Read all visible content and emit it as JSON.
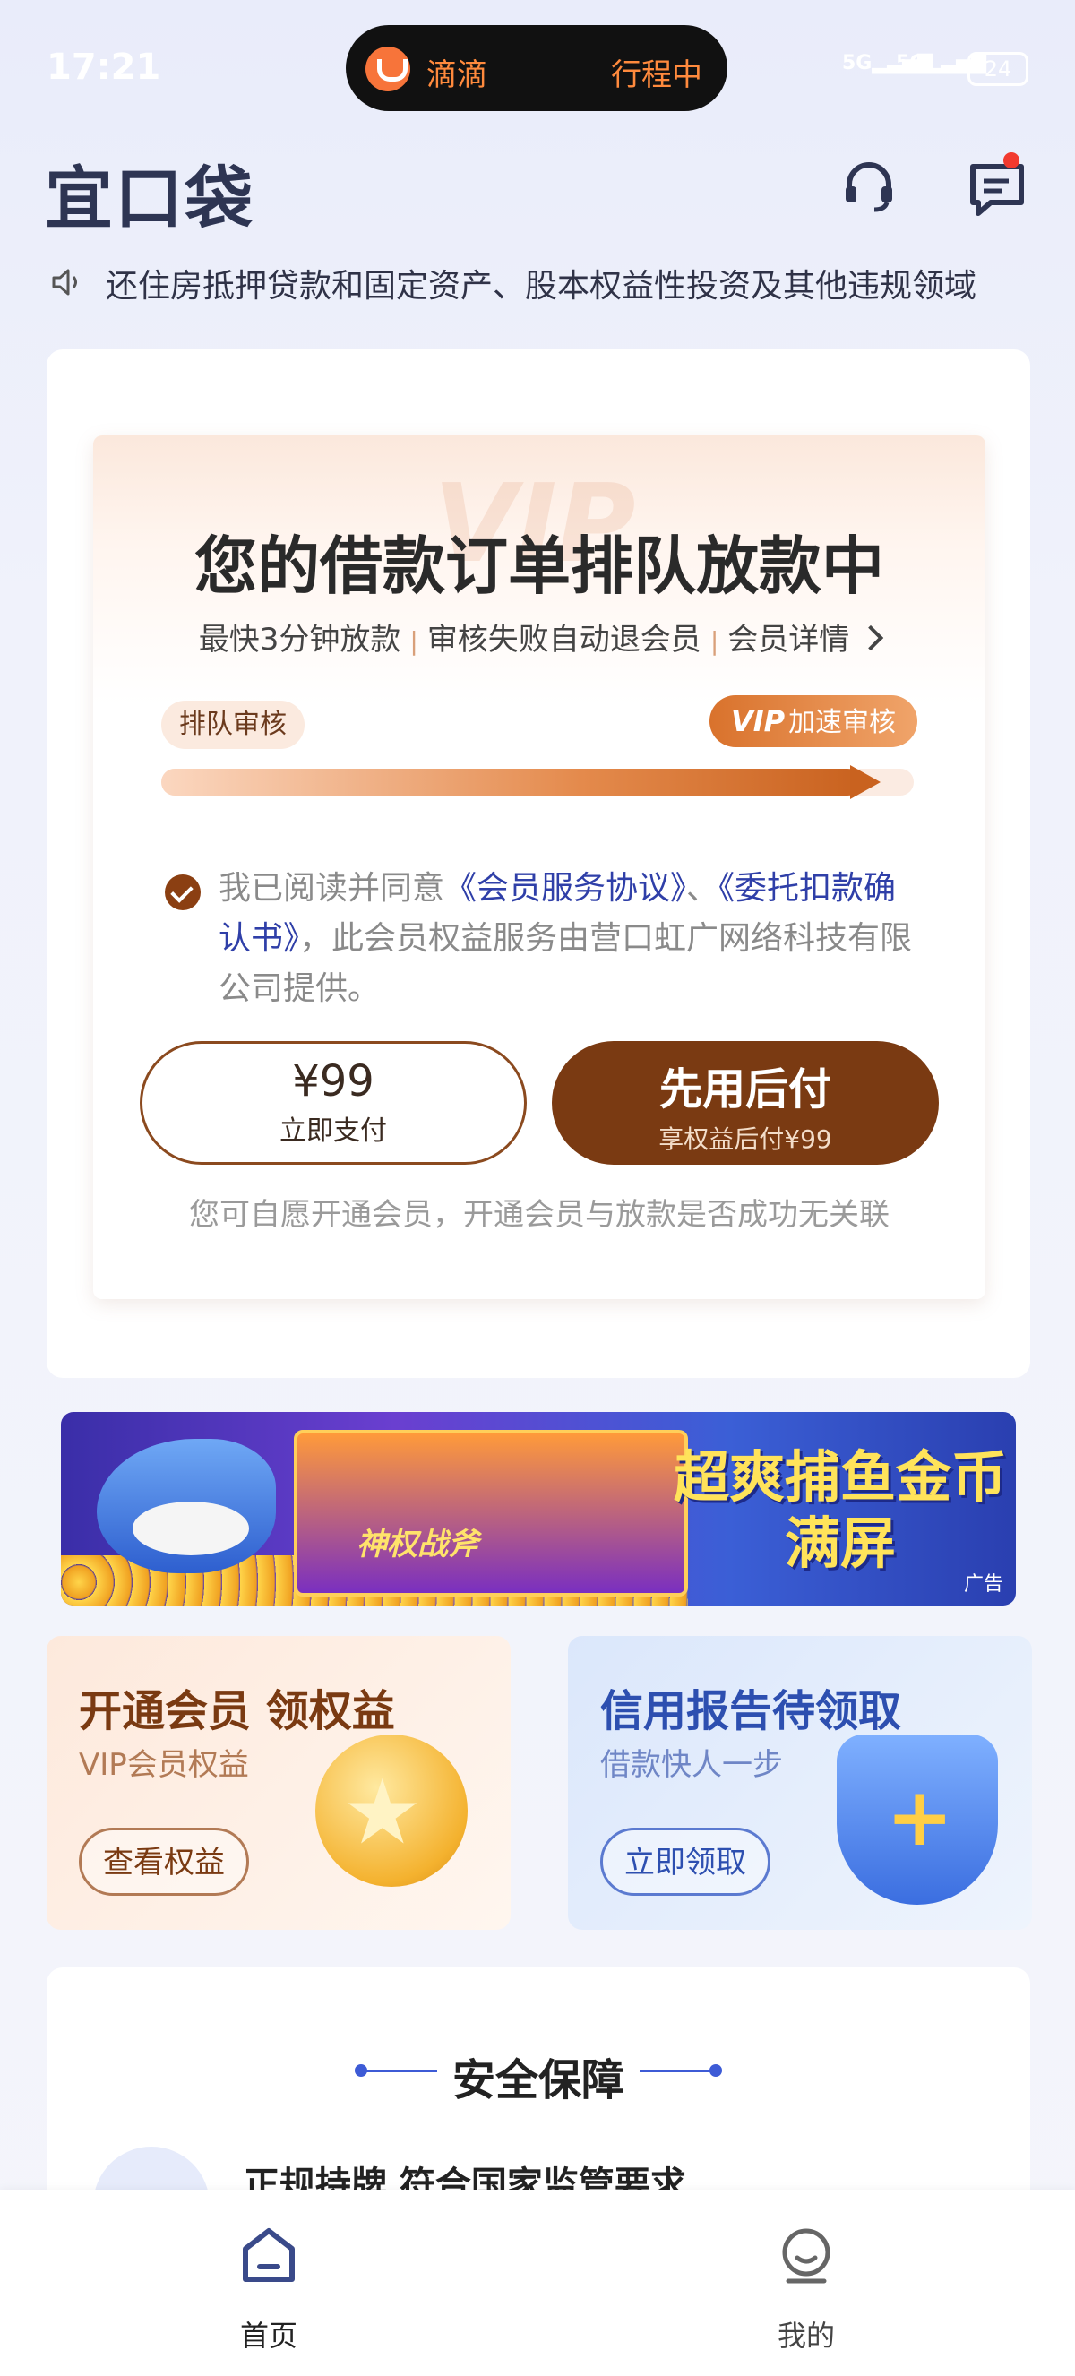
{
  "status_bar": {
    "time": "17:21",
    "app_pill": {
      "name": "滴滴",
      "status": "行程中"
    },
    "signal_1": "5G",
    "signal_2": "5G",
    "battery": "24"
  },
  "header": {
    "app_logo": "宜口袋",
    "icons": [
      "headset-icon",
      "message-icon"
    ],
    "message_has_unread": true
  },
  "notice": {
    "icon": "speaker-icon",
    "text": "还住房抵押贷款和固定资产、股本权益性投资及其他违规领域"
  },
  "loan_card": {
    "watermark": "VIP",
    "title": "您的借款订单排队放款中",
    "features": [
      "最快3分钟放款",
      "审核失败自动退会员",
      "会员详情"
    ],
    "queue_tag": "排队审核",
    "vip_tag_badge": "VIP",
    "vip_tag_label": "加速审核",
    "progress_fraction": 0.93,
    "agreement": {
      "checked": true,
      "prefix": "我已阅读并同意",
      "link1": "《会员服务协议》",
      "separator": "、",
      "link2": "《委托扣款确认书》",
      "suffix": "，此会员权益服务由营口虹广网络科技有限公司提供。"
    },
    "pay_button": {
      "price": "¥99",
      "label": "立即支付"
    },
    "later_button": {
      "label": "先用后付",
      "sub": "享权益后付¥99"
    },
    "disclaimer": "您可自愿开通会员，开通会员与放款是否成功无关联"
  },
  "ad_banner": {
    "slot_text": "神权战斧",
    "title": "超爽捕鱼金币满屏",
    "label": "广告"
  },
  "promo_cards": [
    {
      "title": "开通会员 领权益",
      "subtitle": "VIP会员权益",
      "button": "查看权益",
      "icon": "coin-star-icon"
    },
    {
      "title": "信用报告待领取",
      "subtitle": "借款快人一步",
      "button": "立即领取",
      "icon": "shield-plus-icon"
    }
  ],
  "security": {
    "title": "安全保障",
    "item": "正规持牌 符合国家监管要求"
  },
  "tab_bar": {
    "tabs": [
      {
        "label": "首页",
        "icon": "home-icon",
        "active": true
      },
      {
        "label": "我的",
        "icon": "profile-icon",
        "active": false
      }
    ]
  },
  "colors": {
    "accent_brown": "#7a3a12",
    "link_blue": "#2f3fa8",
    "orange": "#e48a4c"
  }
}
